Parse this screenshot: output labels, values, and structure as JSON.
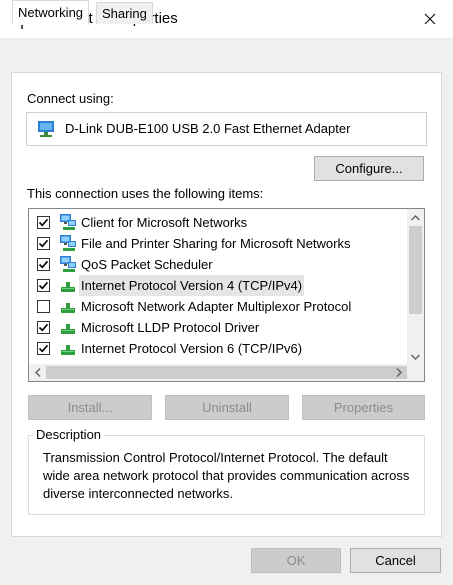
{
  "window": {
    "title": "Ethernet 2 Properties",
    "icon": "network-adapter-icon"
  },
  "tabs": [
    {
      "label": "Networking",
      "active": true
    },
    {
      "label": "Sharing",
      "active": false
    }
  ],
  "connect_using": {
    "label": "Connect using:",
    "adapter_name": "D-Link DUB-E100 USB 2.0 Fast Ethernet Adapter",
    "adapter_icon": "network-adapter-icon"
  },
  "configure_button": "Configure...",
  "items_label": "This connection uses the following items:",
  "items": [
    {
      "label": "Client for Microsoft Networks",
      "checked": true,
      "icon": "client-network-icon",
      "selected": false
    },
    {
      "label": "File and Printer Sharing for Microsoft Networks",
      "checked": true,
      "icon": "client-network-icon",
      "selected": false
    },
    {
      "label": "QoS Packet Scheduler",
      "checked": true,
      "icon": "client-network-icon",
      "selected": false
    },
    {
      "label": "Internet Protocol Version 4 (TCP/IPv4)",
      "checked": true,
      "icon": "protocol-icon",
      "selected": true
    },
    {
      "label": "Microsoft Network Adapter Multiplexor Protocol",
      "checked": false,
      "icon": "protocol-icon",
      "selected": false
    },
    {
      "label": "Microsoft LLDP Protocol Driver",
      "checked": true,
      "icon": "protocol-icon",
      "selected": false
    },
    {
      "label": "Internet Protocol Version 6 (TCP/IPv6)",
      "checked": true,
      "icon": "protocol-icon",
      "selected": false
    }
  ],
  "buttons": {
    "install": "Install...",
    "uninstall": "Uninstall",
    "properties": "Properties",
    "ok": "OK",
    "cancel": "Cancel"
  },
  "description": {
    "title": "Description",
    "text": "Transmission Control Protocol/Internet Protocol. The default wide area network protocol that provides communication across diverse interconnected networks."
  }
}
